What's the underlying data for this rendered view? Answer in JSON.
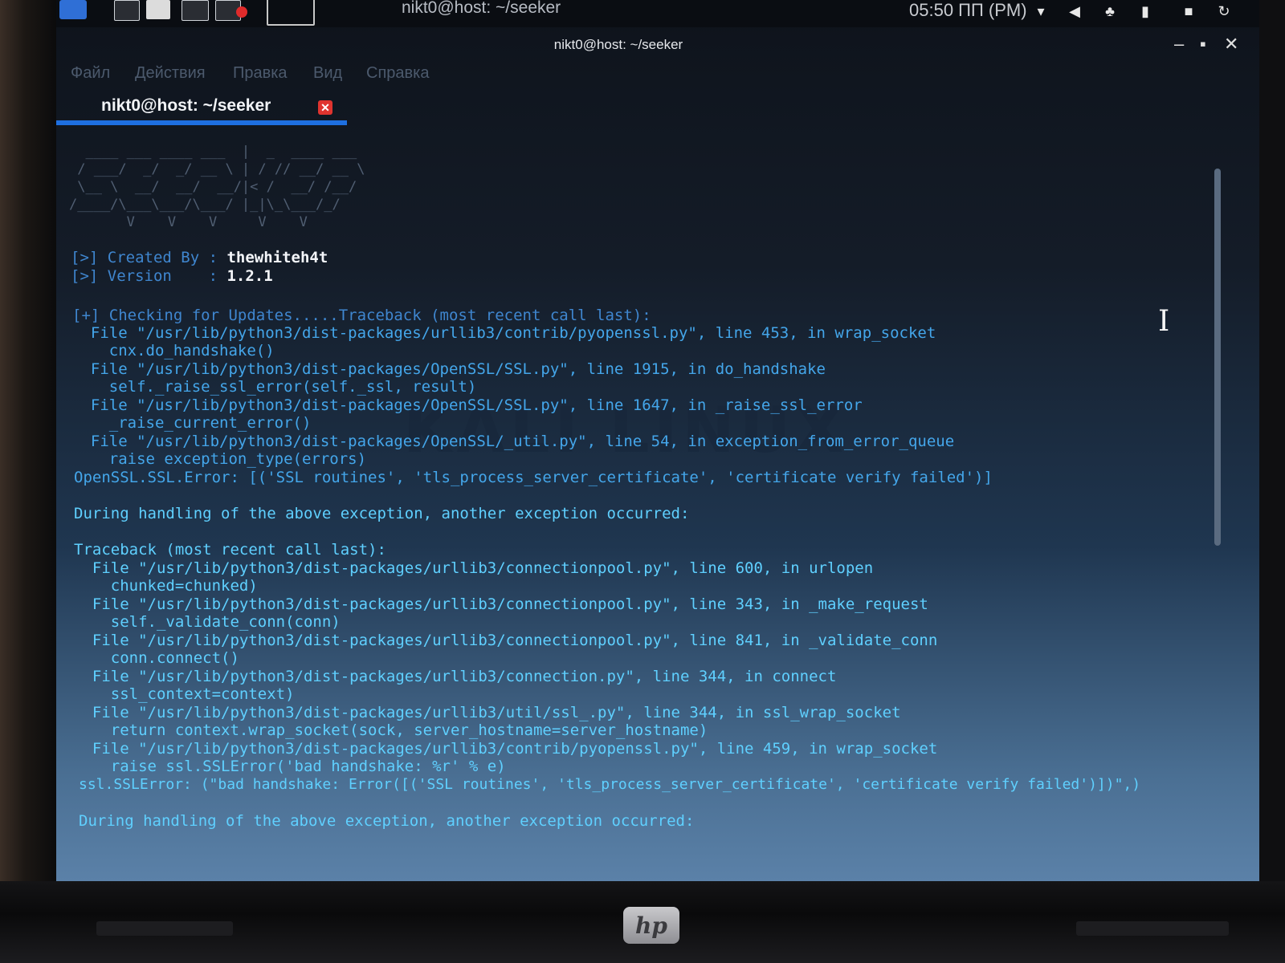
{
  "panel": {
    "window_title": "nikt0@host: ~/seeker",
    "clock": "05:50 ПП (PM)",
    "icons": [
      "wifi-icon",
      "volume-icon",
      "bell-icon",
      "battery-icon",
      "lock-icon",
      "power-icon"
    ]
  },
  "window": {
    "title": "nikt0@host: ~/seeker",
    "controls": {
      "minimize": "–",
      "maximize": "▪",
      "close": "✕"
    }
  },
  "menu": [
    "Файл",
    "Действия",
    "Правка",
    "Вид",
    "Справка"
  ],
  "tab": {
    "label": "nikt0@host: ~/seeker",
    "close": "✕"
  },
  "banner": {
    "created_prefix": "[>] Created By : ",
    "created_value": "thewhiteh4t",
    "version_prefix": "[>] Version    : ",
    "version_value": "1.2.1"
  },
  "output": [
    "[+] Checking for Updates.....Traceback (most recent call last):",
    "  File \"/usr/lib/python3/dist-packages/urllib3/contrib/pyopenssl.py\", line 453, in wrap_socket",
    "    cnx.do_handshake()",
    "  File \"/usr/lib/python3/dist-packages/OpenSSL/SSL.py\", line 1915, in do_handshake",
    "    self._raise_ssl_error(self._ssl, result)",
    "  File \"/usr/lib/python3/dist-packages/OpenSSL/SSL.py\", line 1647, in _raise_ssl_error",
    "    _raise_current_error()",
    "  File \"/usr/lib/python3/dist-packages/OpenSSL/_util.py\", line 54, in exception_from_error_queue",
    "    raise exception_type(errors)",
    "OpenSSL.SSL.Error: [('SSL routines', 'tls_process_server_certificate', 'certificate verify failed')]",
    "",
    "During handling of the above exception, another exception occurred:",
    "",
    "Traceback (most recent call last):",
    "  File \"/usr/lib/python3/dist-packages/urllib3/connectionpool.py\", line 600, in urlopen",
    "    chunked=chunked)",
    "  File \"/usr/lib/python3/dist-packages/urllib3/connectionpool.py\", line 343, in _make_request",
    "    self._validate_conn(conn)",
    "  File \"/usr/lib/python3/dist-packages/urllib3/connectionpool.py\", line 841, in _validate_conn",
    "    conn.connect()",
    "  File \"/usr/lib/python3/dist-packages/urllib3/connection.py\", line 344, in connect",
    "    ssl_context=context)",
    "  File \"/usr/lib/python3/dist-packages/urllib3/util/ssl_.py\", line 344, in ssl_wrap_socket",
    "    return context.wrap_socket(sock, server_hostname=server_hostname)",
    "  File \"/usr/lib/python3/dist-packages/urllib3/contrib/pyopenssl.py\", line 459, in wrap_socket",
    "    raise ssl.SSLError('bad handshake: %r' % e)",
    "ssl.SSLError: (\"bad handshake: Error([('SSL routines', 'tls_process_server_certificate', 'certificate verify failed')])\",)",
    "",
    "During handling of the above exception, another exception occurred:"
  ],
  "watermark": "KALI LINUX",
  "laptop_logo": "hp",
  "colors": {
    "accent": "#1e6fe0",
    "text": "#3f86cf",
    "close": "#e0342f"
  }
}
